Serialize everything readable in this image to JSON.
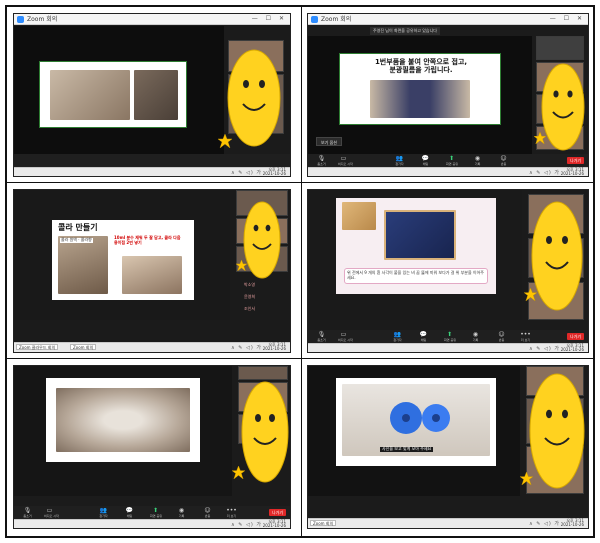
{
  "window": {
    "title": "Zoom 회의",
    "buttons": "— ☐ ✕"
  },
  "toolbar": {
    "items": [
      {
        "icon": "mic-off-icon",
        "glyph": "🎙",
        "label": "음소거"
      },
      {
        "icon": "video-icon",
        "glyph": "▭",
        "label": "비디오 시작"
      },
      {
        "icon": "participants-icon",
        "glyph": "👥",
        "label": "참가자"
      },
      {
        "icon": "chat-icon",
        "glyph": "💬",
        "label": "채팅"
      },
      {
        "icon": "share-screen-icon",
        "glyph": "⬆",
        "label": "화면 공유"
      },
      {
        "icon": "record-icon",
        "glyph": "◉",
        "label": "기록"
      },
      {
        "icon": "reactions-icon",
        "glyph": "☺",
        "label": "반응"
      },
      {
        "icon": "more-icon",
        "glyph": "•••",
        "label": "더 보기"
      }
    ],
    "end_label": "나가기"
  },
  "taskbar": {
    "tray": "∧ ✎ ◁) 가",
    "time": "오후 3:11",
    "date": "2021-10-26"
  },
  "panels": [
    {
      "id": "p1",
      "slide_lines": []
    },
    {
      "id": "p2",
      "slide_title": "1번부품을 붙여 안쪽으로 접고,\n분광필름을 가립니다.",
      "notice": "주영진 님이 화면을 공유하고 있습니다",
      "chip": "보기 옵션"
    },
    {
      "id": "p3",
      "slide_title": "콜라 만들기",
      "slide_label": "콜라 원액 · 콜라향",
      "slide_note": "10ml 분수 재워 두 잘 담고, 콜라 다음\n용이접 2번 넣기",
      "side_items": [
        "박소영",
        "윤영희",
        "조인서"
      ],
      "taskbar_apps": [
        "Zoom 클라우드 회의",
        "Zoom 회의"
      ]
    },
    {
      "id": "p4",
      "slide_caption": "위 전에서 9 개의 흰 사각이 붙을 있는 비 꿈 뚫에 끼워 보다가 걸 위 부분을 이어주세요."
    },
    {
      "id": "p5",
      "slide_lines": []
    },
    {
      "id": "p6",
      "slide_caption": "사진을 보고 맞게 모아 주세요",
      "taskbar_apps": [
        "Zoom 회의"
      ]
    }
  ]
}
